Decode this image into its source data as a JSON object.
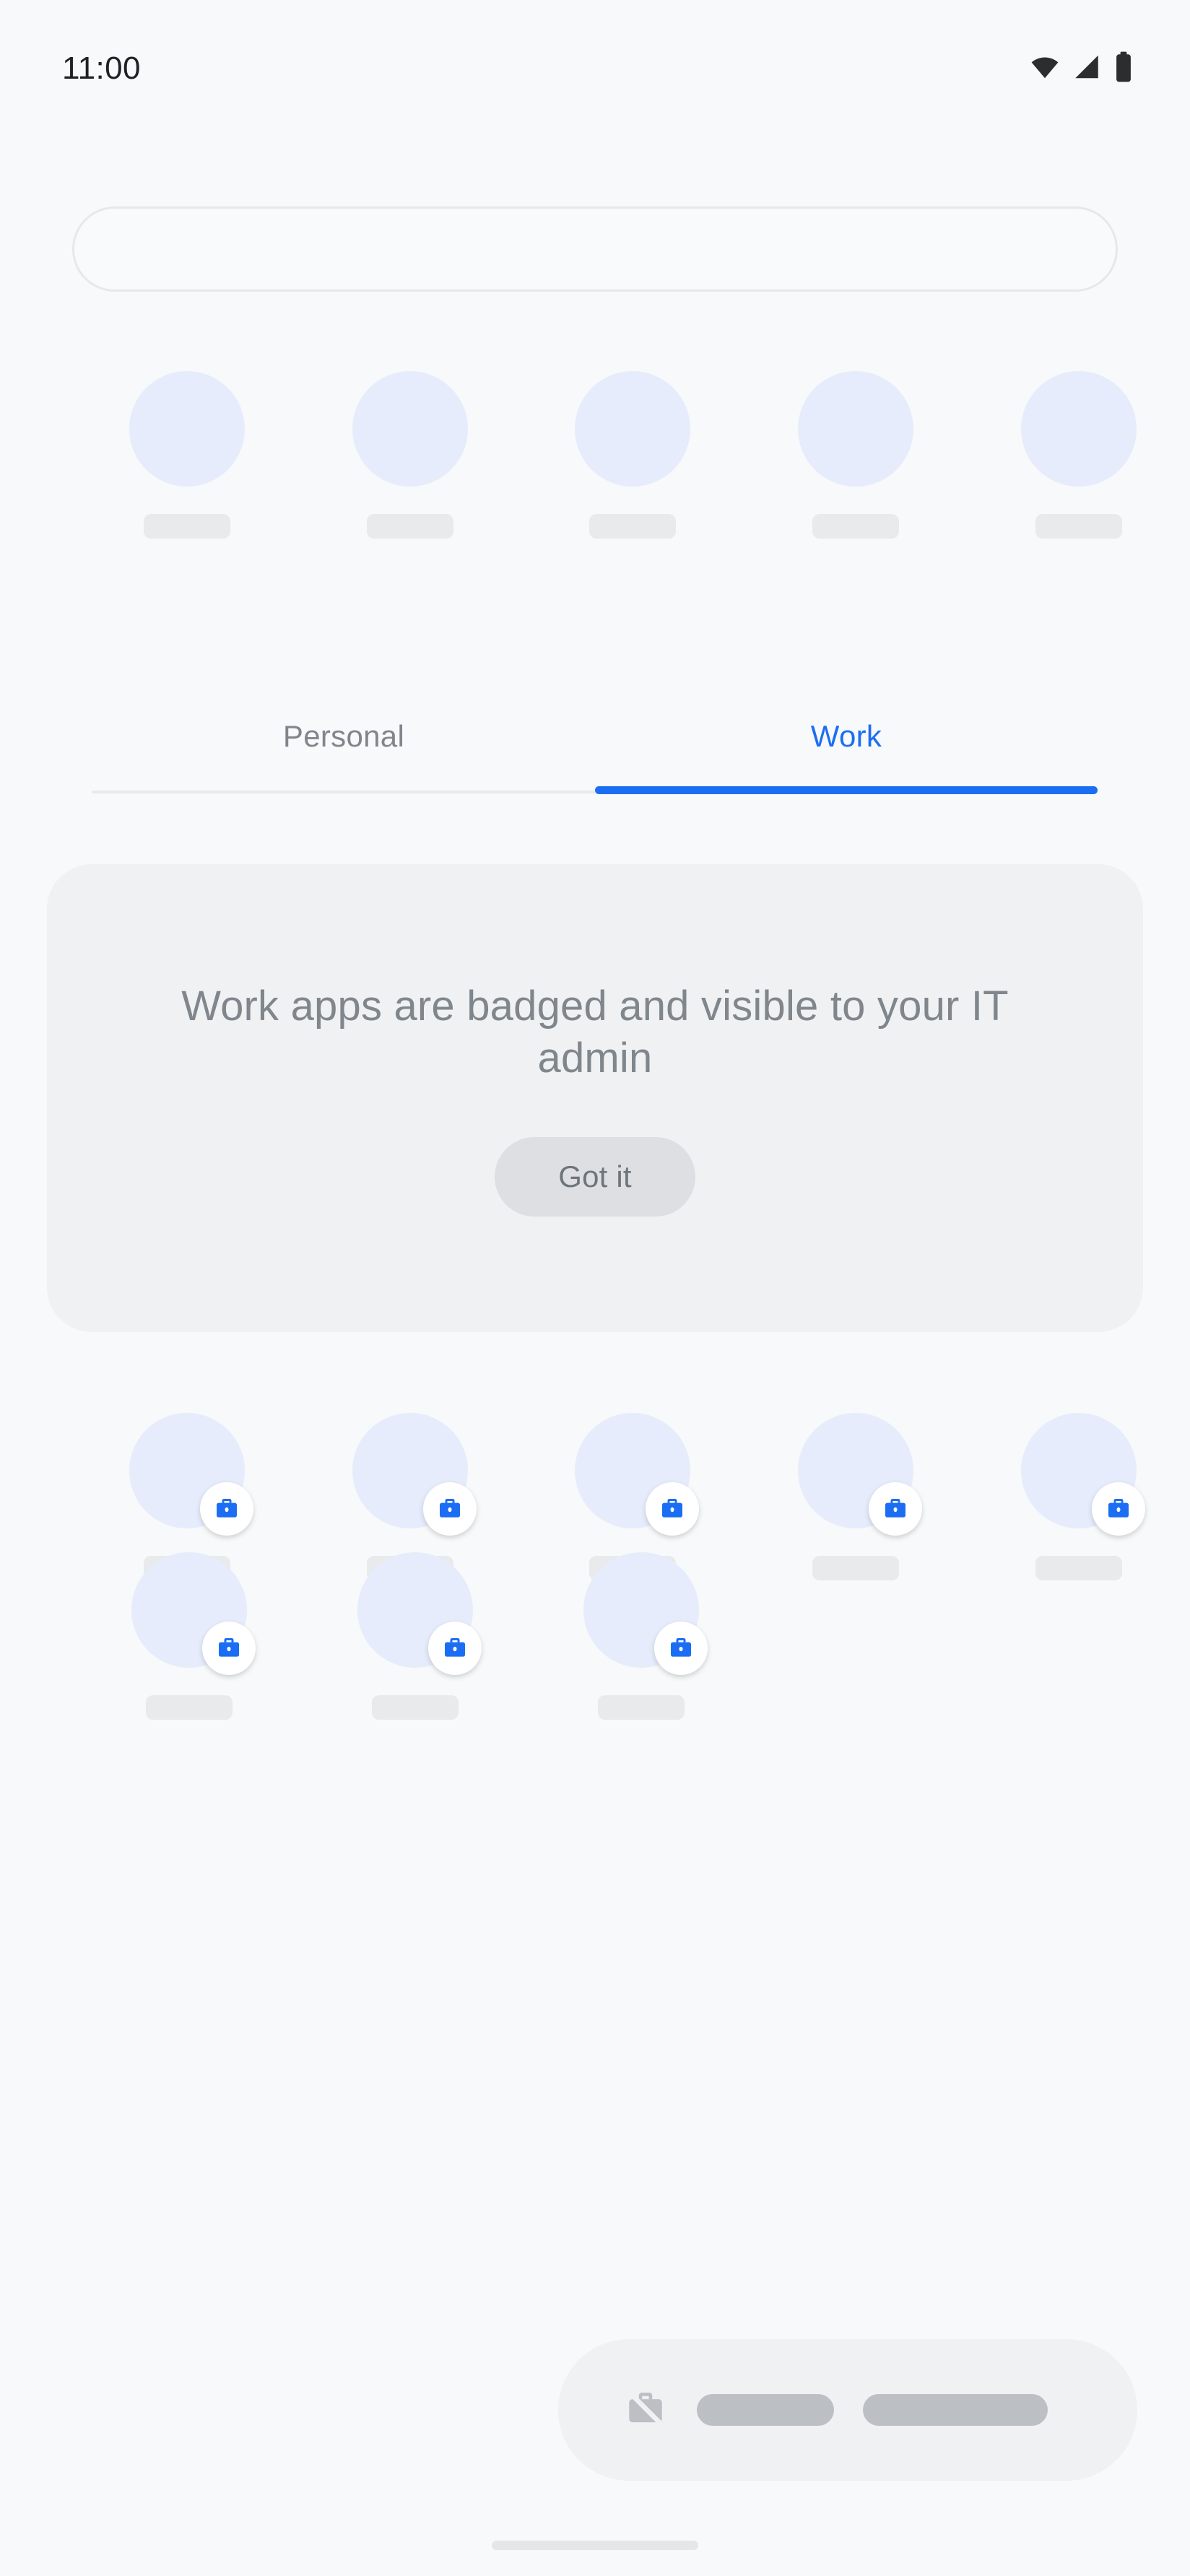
{
  "status_bar": {
    "time": "11:00",
    "icons": [
      "wifi-icon",
      "cellular-signal-icon",
      "battery-icon"
    ]
  },
  "search": {
    "value": "",
    "placeholder": ""
  },
  "top_app_row": {
    "count": 5,
    "items": [
      {
        "label": "",
        "badged": false
      },
      {
        "label": "",
        "badged": false
      },
      {
        "label": "",
        "badged": false
      },
      {
        "label": "",
        "badged": false
      },
      {
        "label": "",
        "badged": false
      }
    ]
  },
  "tabs": {
    "items": [
      {
        "label": "Personal",
        "selected": false
      },
      {
        "label": "Work",
        "selected": true
      }
    ],
    "active_index": 1,
    "active_color": "#1B6EF3",
    "inactive_color": "#80868B"
  },
  "info_card": {
    "message": "Work apps are badged and visible to your IT admin",
    "button_label": "Got it",
    "background": "#F0F1F3",
    "text_color": "#7F868C"
  },
  "work_apps": {
    "badge_icon": "briefcase-icon",
    "badge_color": "#1B6EF3",
    "rows": [
      {
        "items": [
          {
            "label": "",
            "badged": true
          },
          {
            "label": "",
            "badged": true
          },
          {
            "label": "",
            "badged": true
          },
          {
            "label": "",
            "badged": true
          },
          {
            "label": "",
            "badged": true
          }
        ]
      },
      {
        "items": [
          {
            "label": "",
            "badged": true
          },
          {
            "label": "",
            "badged": true
          },
          {
            "label": "",
            "badged": true
          }
        ]
      }
    ]
  },
  "bottom_bar": {
    "icon": "work-profile-off-icon",
    "pills": [
      "",
      ""
    ]
  },
  "nav_handle": {
    "label": "home-gesture-handle"
  },
  "theme": {
    "background": "#F7F9FA",
    "icon_placeholder": "#E6ECFB",
    "label_placeholder": "#E8EAEC",
    "accent": "#1B6EF3"
  }
}
